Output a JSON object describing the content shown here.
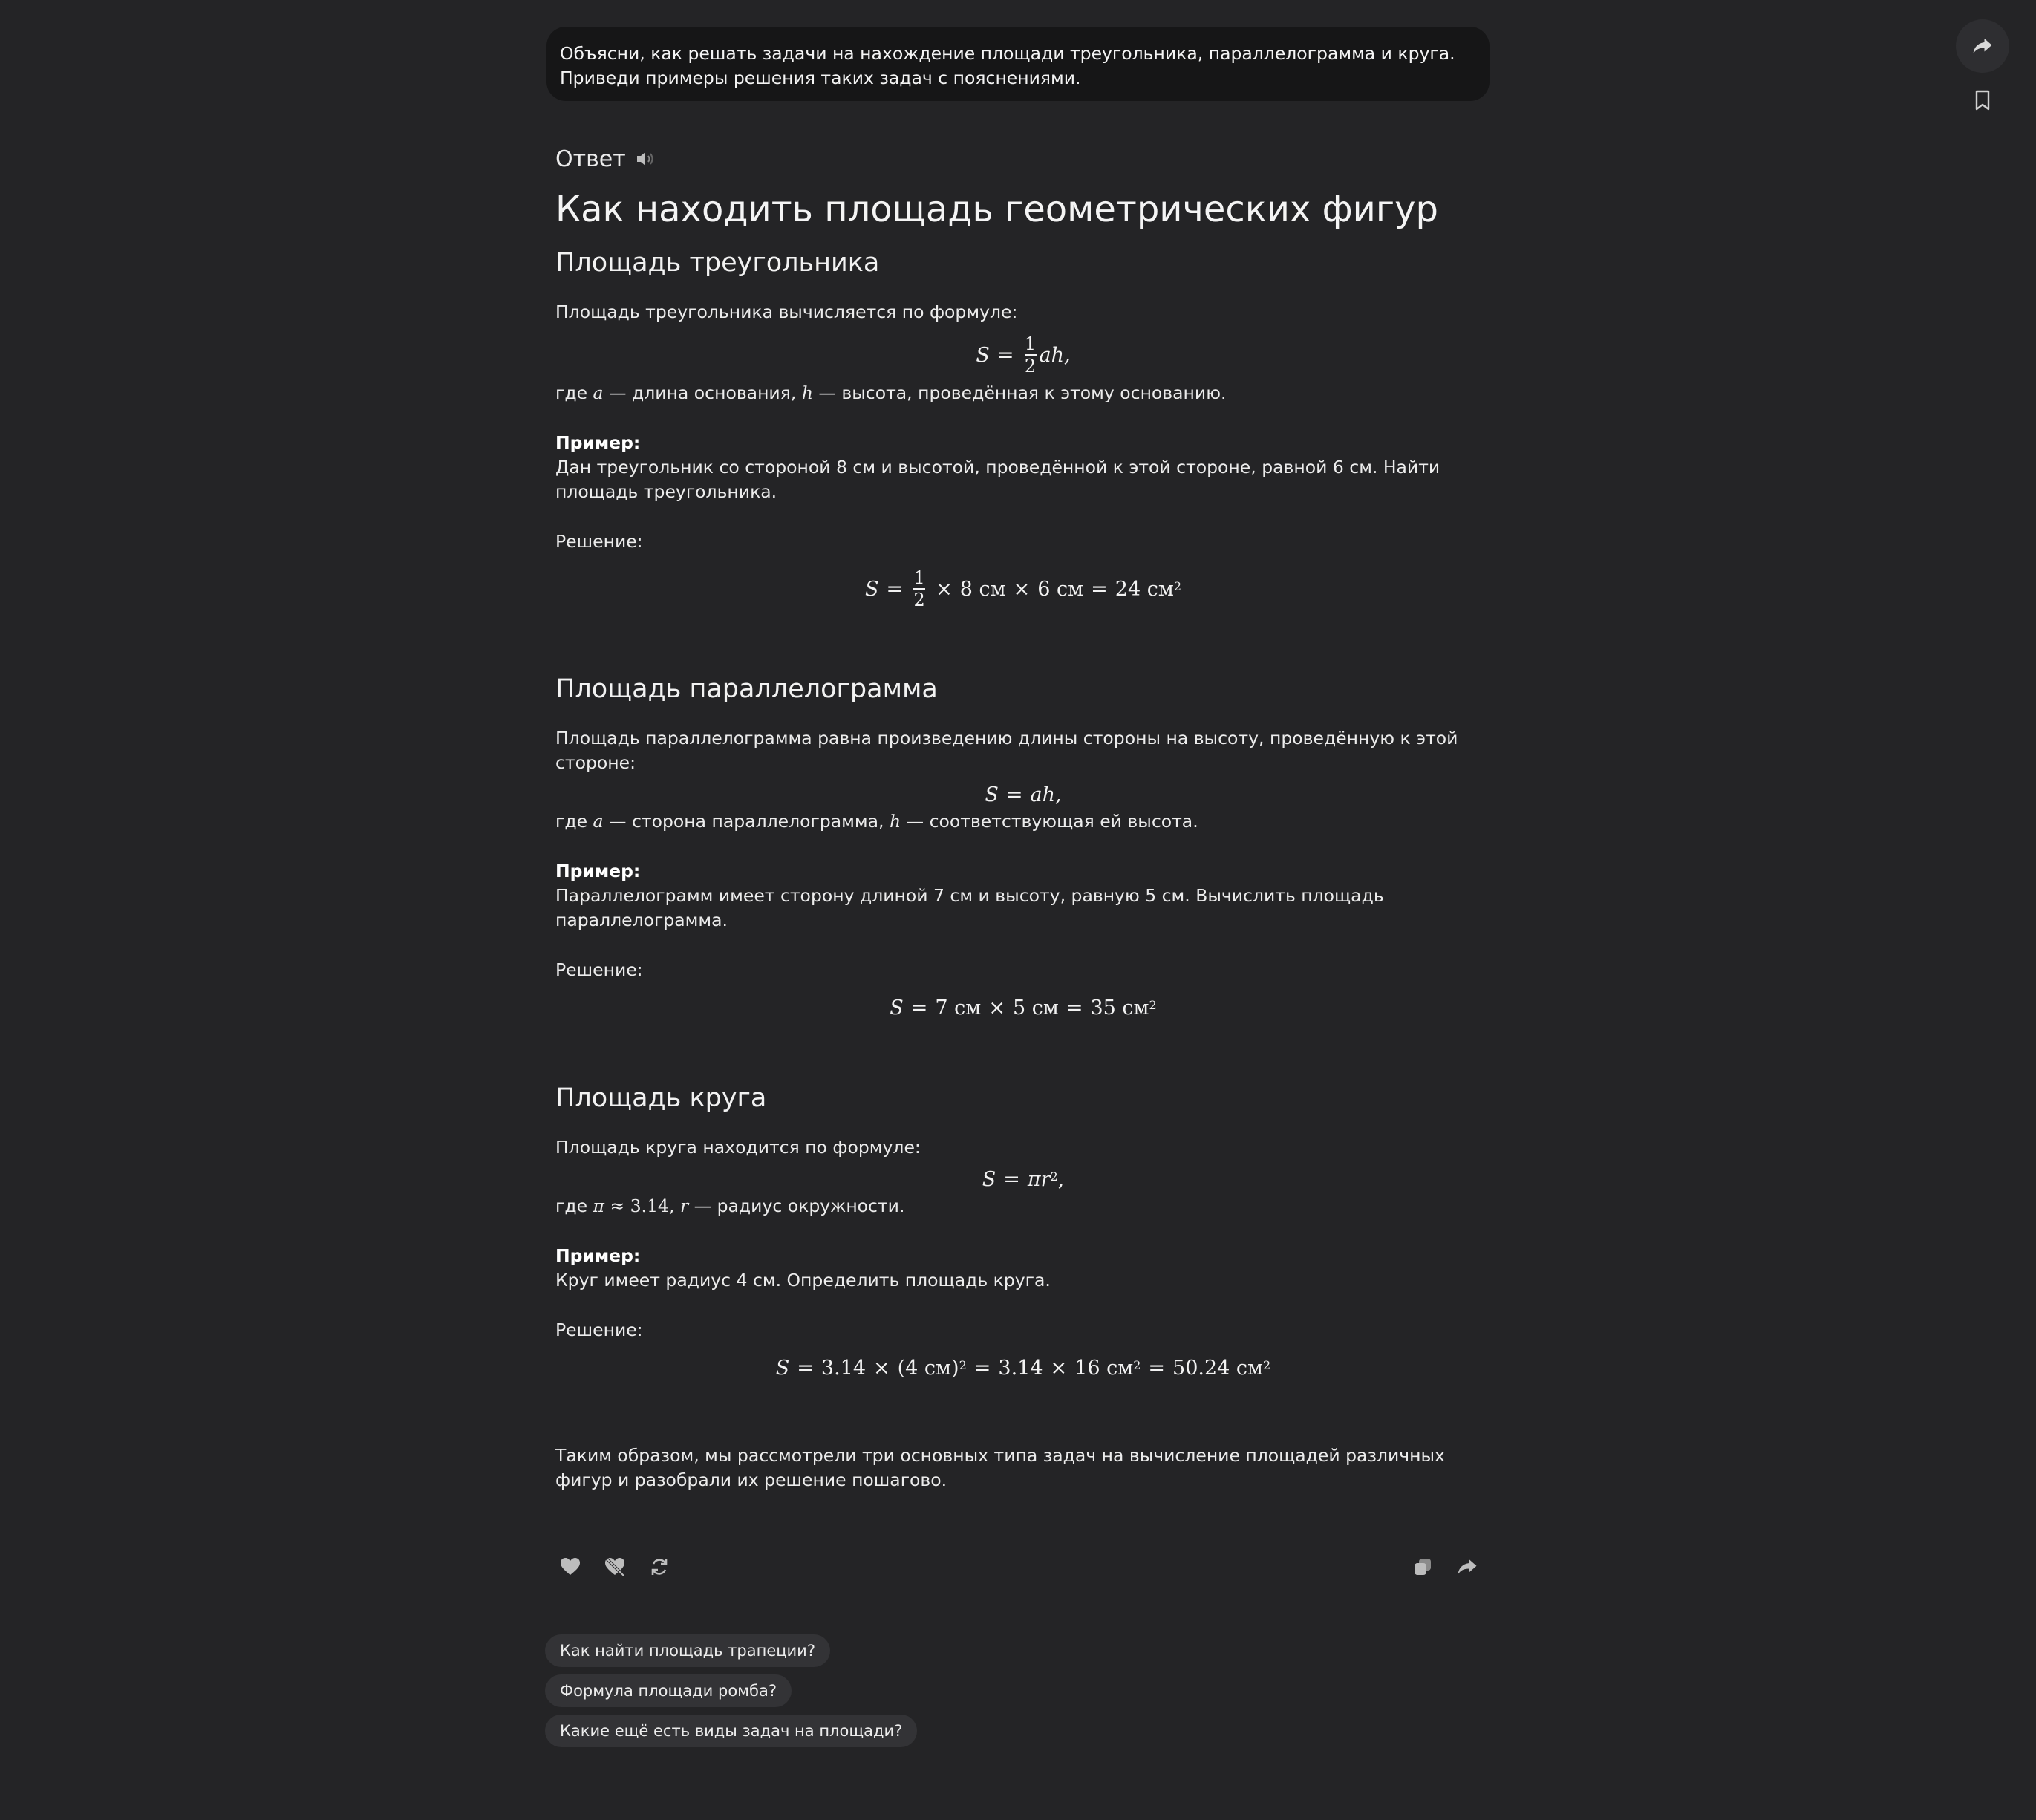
{
  "user_message": "Объясни, как решать задачи на нахождение площади треугольника, параллелограмма и круга. Приведи примеры решения таких задач с пояснениями.",
  "answer": {
    "label": "Ответ",
    "title": "Как находить площадь геометрических фигур",
    "triangle": {
      "heading": "Площадь треугольника",
      "intro": "Площадь треугольника вычисляется по формуле:",
      "formula": {
        "lhs": "S",
        "eq": "=",
        "num": "1",
        "den": "2",
        "rest": "ah,"
      },
      "where": {
        "pre": "где",
        "a": "a",
        "a_desc": " — длина основания,",
        "h": "h",
        "h_desc": " — высота, проведённая к этому основанию."
      },
      "example_label": "Пример:",
      "example_text": "Дан треугольник со стороной 8 см и высотой, проведённой к этой стороне, равной 6 см. Найти площадь треугольника.",
      "solution_label": "Решение:",
      "solution": {
        "lhs": "S",
        "num": "1",
        "den": "2",
        "part1": "8 см",
        "part2": "6 см",
        "result": "24 см",
        "exp": "2"
      }
    },
    "parallelogram": {
      "heading": "Площадь параллелограмма",
      "intro": "Площадь параллелограмма равна произведению длины стороны на высоту, проведённую к этой стороне:",
      "formula": {
        "lhs": "S",
        "rhs": "ah,"
      },
      "where": {
        "pre": "где",
        "a": "a",
        "a_desc": " — сторона параллелограмма,",
        "h": "h",
        "h_desc": " — соответствующая ей высота."
      },
      "example_label": "Пример:",
      "example_text": "Параллелограмм имеет сторону длиной 7 см и высоту, равную 5 см. Вычислить площадь параллелограмма.",
      "solution_label": "Решение:",
      "solution": {
        "lhs": "S",
        "part1": "7 см",
        "part2": "5 см",
        "result": "35 см",
        "exp": "2"
      }
    },
    "circle": {
      "heading": "Площадь круга",
      "intro": "Площадь круга находится по формуле:",
      "formula": {
        "lhs": "S",
        "rhs": "πr",
        "exp": "2",
        "tail": ","
      },
      "where": {
        "pre": "где",
        "pi": "π",
        "approx": "≈ 3.14,",
        "r": "r",
        "r_desc": " — радиус окружности."
      },
      "example_label": "Пример:",
      "example_text": "Круг имеет радиус 4 см. Определить площадь круга.",
      "solution_label": "Решение:",
      "solution": {
        "lhs": "S",
        "part1": "3.14",
        "part2": "(4 см)",
        "exp1": "2",
        "part3": "3.14",
        "part4": "16 см",
        "exp2": "2",
        "result": "50.24 см",
        "exp3": "2"
      }
    },
    "conclusion": "Таким образом, мы рассмотрели три основных типа задач на вычисление площадей различных фигур и разобрали их решение пошагово."
  },
  "suggestions": [
    "Как найти площадь трапеции?",
    "Формула площади ромба?",
    "Какие ещё есть виды задач на площади?"
  ],
  "icons": {
    "share": "share-arrow-icon",
    "bookmark": "bookmark-icon",
    "speaker": "speaker-icon",
    "like": "heart-icon",
    "dislike": "heart-broken-icon",
    "regenerate": "refresh-icon",
    "copy": "copy-icon",
    "forward": "share-arrow-icon"
  }
}
